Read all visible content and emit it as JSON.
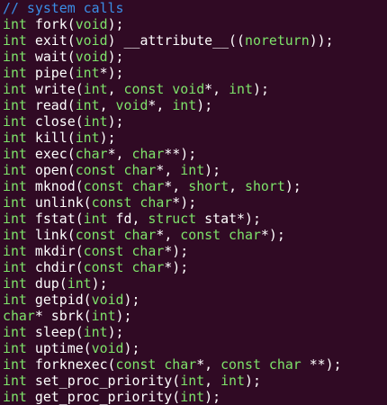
{
  "editor": {
    "colors": {
      "background": "#300a24",
      "comment": "#3a8ee6",
      "type": "#7ee36a",
      "plain": "#ffffff",
      "constant": "#ff6fd0"
    },
    "lines": [
      [
        {
          "t": "// system calls",
          "k": "comment"
        }
      ],
      [
        {
          "t": "int",
          "k": "type"
        },
        {
          "t": " fork(",
          "k": "plain"
        },
        {
          "t": "void",
          "k": "type"
        },
        {
          "t": ");",
          "k": "plain"
        }
      ],
      [
        {
          "t": "int",
          "k": "type"
        },
        {
          "t": " exit(",
          "k": "plain"
        },
        {
          "t": "void",
          "k": "type"
        },
        {
          "t": ") __attribute__((",
          "k": "plain"
        },
        {
          "t": "noreturn",
          "k": "type"
        },
        {
          "t": "));",
          "k": "plain"
        }
      ],
      [
        {
          "t": "int",
          "k": "type"
        },
        {
          "t": " wait(",
          "k": "plain"
        },
        {
          "t": "void",
          "k": "type"
        },
        {
          "t": ");",
          "k": "plain"
        }
      ],
      [
        {
          "t": "int",
          "k": "type"
        },
        {
          "t": " pipe(",
          "k": "plain"
        },
        {
          "t": "int",
          "k": "type"
        },
        {
          "t": "*);",
          "k": "plain"
        }
      ],
      [
        {
          "t": "int",
          "k": "type"
        },
        {
          "t": " write(",
          "k": "plain"
        },
        {
          "t": "int",
          "k": "type"
        },
        {
          "t": ", ",
          "k": "plain"
        },
        {
          "t": "const void",
          "k": "type"
        },
        {
          "t": "*, ",
          "k": "plain"
        },
        {
          "t": "int",
          "k": "type"
        },
        {
          "t": ");",
          "k": "plain"
        }
      ],
      [
        {
          "t": "int",
          "k": "type"
        },
        {
          "t": " read(",
          "k": "plain"
        },
        {
          "t": "int",
          "k": "type"
        },
        {
          "t": ", ",
          "k": "plain"
        },
        {
          "t": "void",
          "k": "type"
        },
        {
          "t": "*, ",
          "k": "plain"
        },
        {
          "t": "int",
          "k": "type"
        },
        {
          "t": ");",
          "k": "plain"
        }
      ],
      [
        {
          "t": "int",
          "k": "type"
        },
        {
          "t": " close(",
          "k": "plain"
        },
        {
          "t": "int",
          "k": "type"
        },
        {
          "t": ");",
          "k": "plain"
        }
      ],
      [
        {
          "t": "int",
          "k": "type"
        },
        {
          "t": " kill(",
          "k": "plain"
        },
        {
          "t": "int",
          "k": "type"
        },
        {
          "t": ");",
          "k": "plain"
        }
      ],
      [
        {
          "t": "int",
          "k": "type"
        },
        {
          "t": " exec(",
          "k": "plain"
        },
        {
          "t": "char",
          "k": "type"
        },
        {
          "t": "*, ",
          "k": "plain"
        },
        {
          "t": "char",
          "k": "type"
        },
        {
          "t": "**);",
          "k": "plain"
        }
      ],
      [
        {
          "t": "int",
          "k": "type"
        },
        {
          "t": " open(",
          "k": "plain"
        },
        {
          "t": "const char",
          "k": "type"
        },
        {
          "t": "*, ",
          "k": "plain"
        },
        {
          "t": "int",
          "k": "type"
        },
        {
          "t": ");",
          "k": "plain"
        }
      ],
      [
        {
          "t": "int",
          "k": "type"
        },
        {
          "t": " mknod(",
          "k": "plain"
        },
        {
          "t": "const char",
          "k": "type"
        },
        {
          "t": "*, ",
          "k": "plain"
        },
        {
          "t": "short",
          "k": "type"
        },
        {
          "t": ", ",
          "k": "plain"
        },
        {
          "t": "short",
          "k": "type"
        },
        {
          "t": ");",
          "k": "plain"
        }
      ],
      [
        {
          "t": "int",
          "k": "type"
        },
        {
          "t": " unlink(",
          "k": "plain"
        },
        {
          "t": "const char",
          "k": "type"
        },
        {
          "t": "*);",
          "k": "plain"
        }
      ],
      [
        {
          "t": "int",
          "k": "type"
        },
        {
          "t": " fstat(",
          "k": "plain"
        },
        {
          "t": "int",
          "k": "type"
        },
        {
          "t": " fd, ",
          "k": "plain"
        },
        {
          "t": "struct",
          "k": "type"
        },
        {
          "t": " stat*);",
          "k": "plain"
        }
      ],
      [
        {
          "t": "int",
          "k": "type"
        },
        {
          "t": " link(",
          "k": "plain"
        },
        {
          "t": "const char",
          "k": "type"
        },
        {
          "t": "*, ",
          "k": "plain"
        },
        {
          "t": "const char",
          "k": "type"
        },
        {
          "t": "*);",
          "k": "plain"
        }
      ],
      [
        {
          "t": "int",
          "k": "type"
        },
        {
          "t": " mkdir(",
          "k": "plain"
        },
        {
          "t": "const char",
          "k": "type"
        },
        {
          "t": "*);",
          "k": "plain"
        }
      ],
      [
        {
          "t": "int",
          "k": "type"
        },
        {
          "t": " chdir(",
          "k": "plain"
        },
        {
          "t": "const char",
          "k": "type"
        },
        {
          "t": "*);",
          "k": "plain"
        }
      ],
      [
        {
          "t": "int",
          "k": "type"
        },
        {
          "t": " dup(",
          "k": "plain"
        },
        {
          "t": "int",
          "k": "type"
        },
        {
          "t": ");",
          "k": "plain"
        }
      ],
      [
        {
          "t": "int",
          "k": "type"
        },
        {
          "t": " getpid(",
          "k": "plain"
        },
        {
          "t": "void",
          "k": "type"
        },
        {
          "t": ");",
          "k": "plain"
        }
      ],
      [
        {
          "t": "char",
          "k": "type"
        },
        {
          "t": "* sbrk(",
          "k": "plain"
        },
        {
          "t": "int",
          "k": "type"
        },
        {
          "t": ");",
          "k": "plain"
        }
      ],
      [
        {
          "t": "int",
          "k": "type"
        },
        {
          "t": " sleep(",
          "k": "plain"
        },
        {
          "t": "int",
          "k": "type"
        },
        {
          "t": ");",
          "k": "plain"
        }
      ],
      [
        {
          "t": "int",
          "k": "type"
        },
        {
          "t": " uptime(",
          "k": "plain"
        },
        {
          "t": "void",
          "k": "type"
        },
        {
          "t": ");",
          "k": "plain"
        }
      ],
      [
        {
          "t": "int",
          "k": "type"
        },
        {
          "t": " forknexec(",
          "k": "plain"
        },
        {
          "t": "const char",
          "k": "type"
        },
        {
          "t": "*, ",
          "k": "plain"
        },
        {
          "t": "const char",
          "k": "type"
        },
        {
          "t": " **);",
          "k": "plain"
        }
      ],
      [
        {
          "t": "int",
          "k": "type"
        },
        {
          "t": " set_proc_priority(",
          "k": "plain"
        },
        {
          "t": "int",
          "k": "type"
        },
        {
          "t": ", ",
          "k": "plain"
        },
        {
          "t": "int",
          "k": "type"
        },
        {
          "t": ");",
          "k": "plain"
        }
      ],
      [
        {
          "t": "int",
          "k": "type"
        },
        {
          "t": " get_proc_priority(",
          "k": "plain"
        },
        {
          "t": "int",
          "k": "type"
        },
        {
          "t": ");",
          "k": "plain"
        }
      ]
    ]
  }
}
